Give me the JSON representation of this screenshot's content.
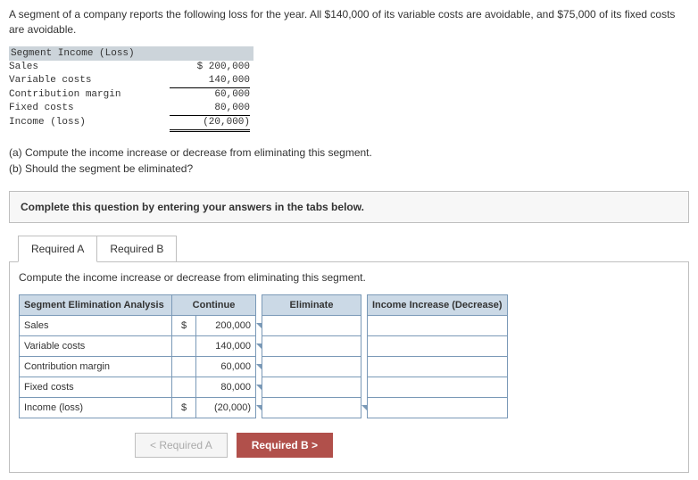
{
  "intro": "A segment of a company reports the following loss for the year. All $140,000 of its variable costs are avoidable, and $75,000 of its fixed costs are avoidable.",
  "statement": {
    "title": "Segment Income (Loss)",
    "rows": [
      {
        "label": "Sales",
        "value": "$ 200,000"
      },
      {
        "label": "Variable costs",
        "value": "140,000"
      },
      {
        "label": "Contribution margin",
        "value": "60,000"
      },
      {
        "label": "Fixed costs",
        "value": "80,000"
      },
      {
        "label": "Income (loss)",
        "value": "(20,000)"
      }
    ]
  },
  "questions": {
    "a": "(a) Compute the income increase or decrease from eliminating this segment.",
    "b": "(b) Should the segment be eliminated?"
  },
  "instruction": "Complete this question by entering your answers in the tabs below.",
  "tabs": {
    "a": "Required A",
    "b": "Required B"
  },
  "pane_instruction": "Compute the income increase or decrease from eliminating this segment.",
  "headers": {
    "seg": "Segment Elimination Analysis",
    "cont": "Continue",
    "elim": "Eliminate",
    "inc": "Income Increase (Decrease)"
  },
  "rows": {
    "sales": {
      "label": "Sales",
      "dollar": "$",
      "value": "200,000"
    },
    "var": {
      "label": "Variable costs",
      "dollar": "",
      "value": "140,000"
    },
    "cm": {
      "label": "Contribution margin",
      "dollar": "",
      "value": "60,000"
    },
    "fc": {
      "label": "Fixed costs",
      "dollar": "",
      "value": "80,000"
    },
    "il": {
      "label": "Income (loss)",
      "dollar": "$",
      "value": "(20,000)"
    }
  },
  "nav": {
    "prev": "<  Required A",
    "next": "Required B  >"
  }
}
